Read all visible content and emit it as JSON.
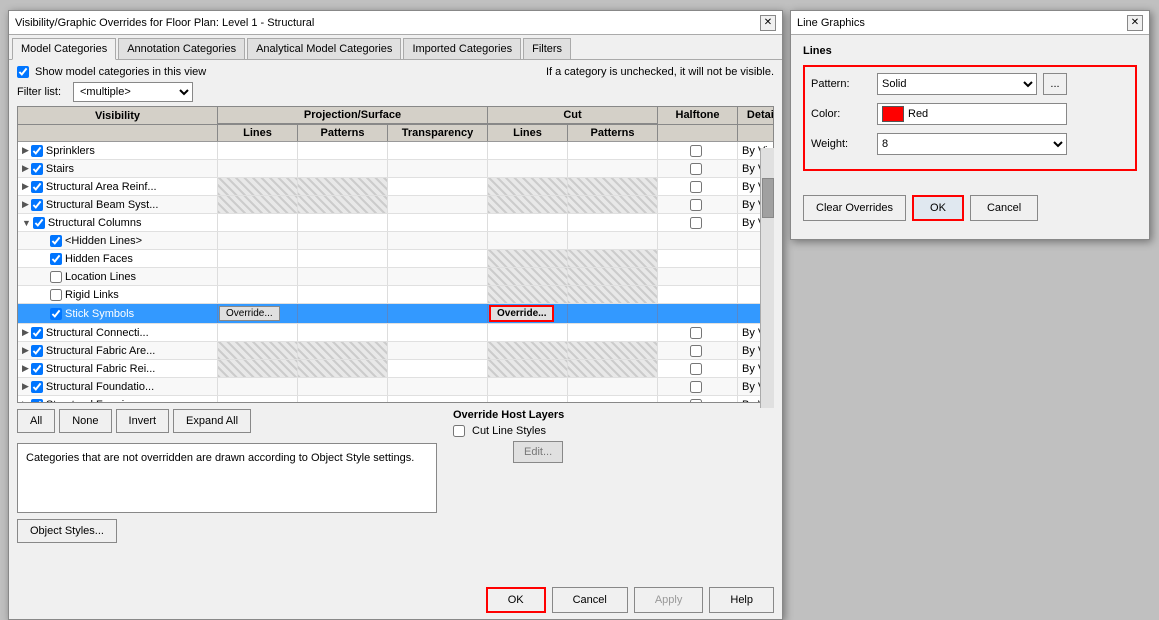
{
  "mainDialog": {
    "title": "Visibility/Graphic Overrides for Floor Plan: Level 1 - Structural",
    "tabs": [
      {
        "label": "Model Categories",
        "active": true
      },
      {
        "label": "Annotation Categories",
        "active": false
      },
      {
        "label": "Analytical Model Categories",
        "active": false
      },
      {
        "label": "Imported Categories",
        "active": false
      },
      {
        "label": "Filters",
        "active": false
      }
    ],
    "showModelCategories": {
      "label": "Show model categories in this view",
      "checked": true
    },
    "filterList": {
      "label": "Filter list:",
      "value": "<multiple>"
    },
    "infoText": "If a category is unchecked, it will not be visible.",
    "tableHeaders": {
      "visibility": "Visibility",
      "projectionSurface": "Projection/Surface",
      "cut": "Cut",
      "halftone": "Halftone",
      "detailLevel": "Detail Level",
      "lines": "Lines",
      "patterns": "Patterns",
      "transparency": "Transparency"
    },
    "rows": [
      {
        "indent": 0,
        "expand": true,
        "checked": true,
        "name": "Sprinklers",
        "col2": "",
        "col3": "",
        "col4": "",
        "col5": "",
        "col6": "",
        "col7": false,
        "col8": "By View",
        "hatched2": false,
        "hatched3": false,
        "hatched5": false,
        "hatched6": false
      },
      {
        "indent": 0,
        "expand": true,
        "checked": true,
        "name": "Stairs",
        "col2": "",
        "col3": "",
        "col4": "",
        "col5": "",
        "col6": "",
        "col7": false,
        "col8": "By View",
        "hatched2": false,
        "hatched3": false,
        "hatched5": false,
        "hatched6": false
      },
      {
        "indent": 0,
        "expand": true,
        "checked": true,
        "name": "Structural Area Reinf...",
        "col2": "",
        "col3": "",
        "col4": "",
        "col5": "",
        "col6": "",
        "col7": false,
        "col8": "By View",
        "hatched2": true,
        "hatched3": true,
        "hatched5": true,
        "hatched6": true
      },
      {
        "indent": 0,
        "expand": true,
        "checked": true,
        "name": "Structural Beam Syst...",
        "col2": "",
        "col3": "",
        "col4": "",
        "col5": "",
        "col6": "",
        "col7": false,
        "col8": "By View",
        "hatched2": true,
        "hatched3": true,
        "hatched5": true,
        "hatched6": true
      },
      {
        "indent": 0,
        "expand": true,
        "checked": true,
        "name": "Structural Columns",
        "col2": "",
        "col3": "",
        "col4": "",
        "col5": "",
        "col6": "",
        "col7": false,
        "col8": "By View",
        "hatched2": false,
        "hatched3": false,
        "hatched5": false,
        "hatched6": false,
        "expanded": true
      },
      {
        "indent": 1,
        "expand": false,
        "checked": true,
        "name": "<Hidden Lines>",
        "col2": "",
        "col3": "",
        "col4": "",
        "col5": "",
        "col6": "",
        "col7": null,
        "col8": null,
        "hatched2": false,
        "hatched3": false,
        "hatched5": false,
        "hatched6": false
      },
      {
        "indent": 1,
        "expand": false,
        "checked": true,
        "name": "Hidden Faces",
        "col2": "",
        "col3": "",
        "col4": "",
        "col5": "",
        "col6": "",
        "col7": null,
        "col8": null,
        "hatched2": false,
        "hatched3": false,
        "hatched5": true,
        "hatched6": true
      },
      {
        "indent": 1,
        "expand": false,
        "checked": false,
        "name": "Location Lines",
        "col2": "",
        "col3": "",
        "col4": "",
        "col5": "",
        "col6": "",
        "col7": null,
        "col8": null,
        "hatched2": false,
        "hatched3": false,
        "hatched5": true,
        "hatched6": true
      },
      {
        "indent": 1,
        "expand": false,
        "checked": false,
        "name": "Rigid Links",
        "col2": "",
        "col3": "",
        "col4": "",
        "col5": "",
        "col6": "",
        "col7": null,
        "col8": null,
        "hatched2": false,
        "hatched3": false,
        "hatched5": true,
        "hatched6": true
      },
      {
        "indent": 1,
        "expand": false,
        "checked": true,
        "name": "Stick Symbols",
        "col2": "Override...",
        "col3": "",
        "col4": "",
        "col5": "Override...",
        "col6": "",
        "col7": null,
        "col8": null,
        "selected": true,
        "overrideHighlight": true
      },
      {
        "indent": 0,
        "expand": true,
        "checked": true,
        "name": "Structural Connecti...",
        "col2": "",
        "col3": "",
        "col4": "",
        "col5": "",
        "col6": "",
        "col7": false,
        "col8": "By View",
        "hatched2": false,
        "hatched3": false,
        "hatched5": false,
        "hatched6": false
      },
      {
        "indent": 0,
        "expand": true,
        "checked": true,
        "name": "Structural Fabric Are...",
        "col2": "",
        "col3": "",
        "col4": "",
        "col5": "",
        "col6": "",
        "col7": false,
        "col8": "By View",
        "hatched2": true,
        "hatched3": true,
        "hatched5": true,
        "hatched6": true
      },
      {
        "indent": 0,
        "expand": true,
        "checked": true,
        "name": "Structural Fabric Rei...",
        "col2": "",
        "col3": "",
        "col4": "",
        "col5": "",
        "col6": "",
        "col7": false,
        "col8": "By View",
        "hatched2": true,
        "hatched3": true,
        "hatched5": true,
        "hatched6": true
      },
      {
        "indent": 0,
        "expand": true,
        "checked": true,
        "name": "Structural Foundatio...",
        "col2": "",
        "col3": "",
        "col4": "",
        "col5": "",
        "col6": "",
        "col7": false,
        "col8": "By View",
        "hatched2": false,
        "hatched3": false,
        "hatched5": false,
        "hatched6": false
      },
      {
        "indent": 0,
        "expand": true,
        "checked": true,
        "name": "Structural Framing",
        "col2": "",
        "col3": "",
        "col4": "",
        "col5": "",
        "col6": "",
        "col7": false,
        "col8": "By View",
        "hatched2": false,
        "hatched3": false,
        "hatched5": false,
        "hatched6": false
      }
    ],
    "buttons": {
      "all": "All",
      "none": "None",
      "invert": "Invert",
      "expandAll": "Expand All"
    },
    "overrideHostLayers": {
      "label": "Override Host Layers",
      "cutLineStyles": {
        "label": "Cut Line Styles",
        "checked": false
      },
      "editBtn": "Edit..."
    },
    "infoBoxText": "Categories that are not overridden are drawn according to Object Style settings.",
    "objectStylesBtn": "Object Styles...",
    "footerButtons": {
      "ok": "OK",
      "cancel": "Cancel",
      "apply": "Apply",
      "help": "Help"
    }
  },
  "lineDialog": {
    "title": "Line Graphics",
    "sections": {
      "lines": "Lines"
    },
    "pattern": {
      "label": "Pattern:",
      "value": "Solid"
    },
    "color": {
      "label": "Color:",
      "value": "Red",
      "hex": "#ff0000"
    },
    "weight": {
      "label": "Weight:",
      "value": "8"
    },
    "buttons": {
      "clearOverrides": "Clear Overrides",
      "ok": "OK",
      "cancel": "Cancel"
    }
  }
}
